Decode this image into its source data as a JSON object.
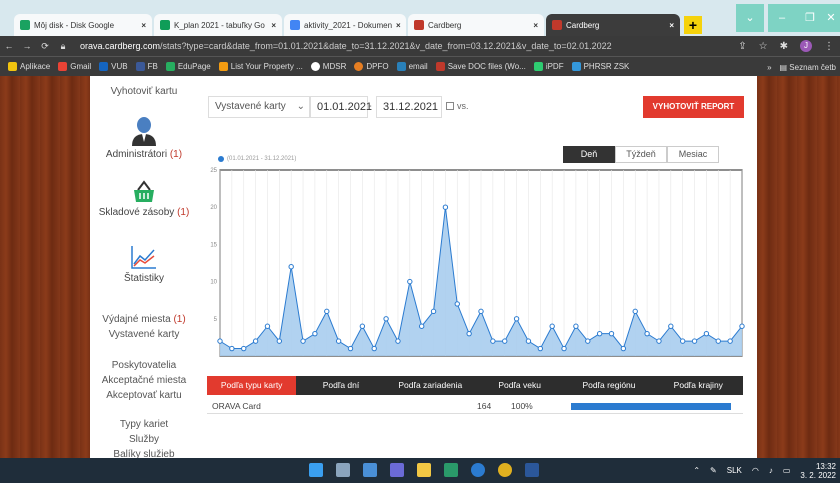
{
  "browser": {
    "tabs": [
      {
        "title": "Môj disk - Disk Google",
        "color": "#1aa260"
      },
      {
        "title": "K_plan 2021 - tabuľky Go",
        "color": "#0f9d58"
      },
      {
        "title": "aktivity_2021 - Dokumen",
        "color": "#4285f4"
      },
      {
        "title": "Cardberg",
        "color": "#c0392b"
      },
      {
        "title": "Cardberg",
        "color": "#c0392b"
      }
    ],
    "url_host": "orava.cardberg.com",
    "url_path": "/stats?type=card&date_from=01.01.2021&date_to=31.12.2021&v_date_from=03.12.2021&v_date_to=02.01.2022",
    "bookmarks": [
      "Aplikace",
      "Gmail",
      "VUB",
      "FB",
      "EduPage",
      "List Your Property ...",
      "MDSR",
      "DPFO",
      "email",
      "Save DOC files (Wo...",
      "iPDF",
      "PHRSR ZSK"
    ],
    "bookmarks_more": "»",
    "reading_list": "Seznam četb",
    "profile_initial": "J"
  },
  "sidebar": {
    "vyhotovit": "Vyhotoviť kartu",
    "administratori": "Administrátori",
    "administratori_count": "(1)",
    "skladove": "Skladové zásoby",
    "skladove_count": "(1)",
    "statistiky": "Štatistiky",
    "vydajne": "Výdajné miesta",
    "vydajne_count": "(1)",
    "vystavene": "Vystavené karty",
    "poskytovatelia": "Poskytovatelia",
    "akceptacne": "Akceptačné miesta",
    "akceptovat": "Akceptovať kartu",
    "typy": "Typy kariet",
    "sluzby": "Služby",
    "baliky": "Balíky služieb"
  },
  "controls": {
    "select_value": "Vystavené karty",
    "date_from": "01.01.2021",
    "date_to": "31.12.2021",
    "vs_label": "vs.",
    "report_button": "VYHOTOVIŤ REPORT",
    "legend": "(01.01.2021 - 31.12.2021)",
    "range": [
      "Deň",
      "Týždeň",
      "Mesiac"
    ]
  },
  "chart_data": {
    "type": "area",
    "ylim": [
      0,
      25
    ],
    "yticks": [
      5,
      10,
      15,
      20,
      25
    ],
    "values": [
      2,
      1,
      1,
      2,
      4,
      2,
      12,
      2,
      3,
      6,
      2,
      1,
      4,
      1,
      5,
      2,
      10,
      4,
      6,
      20,
      7,
      3,
      6,
      2,
      2,
      5,
      2,
      1,
      4,
      1,
      4,
      2,
      3,
      3,
      1,
      6,
      3,
      2,
      4,
      2,
      2,
      3,
      2,
      2,
      4
    ],
    "color": "#2b7bd0",
    "fill": "#a9cdee",
    "grid": "vertical"
  },
  "bottom_tabs": [
    "Podľa typu karty",
    "Podľa dní",
    "Podľa zariadenia",
    "Podľa veku",
    "Podľa regiónu",
    "Podľa krajiny"
  ],
  "table": {
    "name": "ORAVA Card",
    "count": "164",
    "percent": "100%"
  },
  "taskbar": {
    "lang": "SLK",
    "time": "13:32",
    "date": "3. 2. 2022"
  }
}
